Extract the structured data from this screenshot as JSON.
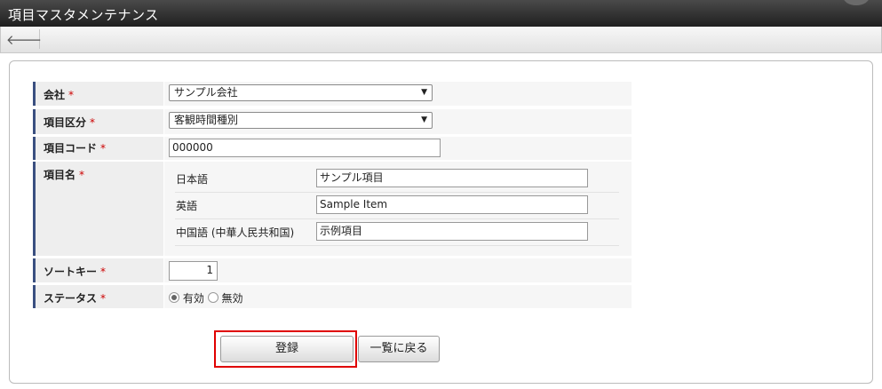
{
  "window": {
    "title": "項目マスタメンテナンス"
  },
  "toolbar": {
    "back_icon": "arrow-left-icon",
    "back_glyph": "🡐"
  },
  "form": {
    "required_mark": "*",
    "company": {
      "label": "会社",
      "value": "サンプル会社"
    },
    "category": {
      "label": "項目区分",
      "value": "客観時間種別"
    },
    "code": {
      "label": "項目コード",
      "value": "000000"
    },
    "name": {
      "label": "項目名",
      "languages": [
        {
          "label": "日本語",
          "value": "サンプル項目"
        },
        {
          "label": "英語",
          "value": "Sample Item"
        },
        {
          "label": "中国語 (中華人民共和国)",
          "value": "示例項目"
        }
      ]
    },
    "sort_key": {
      "label": "ソートキー",
      "value": "1"
    },
    "status": {
      "label": "ステータス",
      "options": [
        {
          "label": "有効",
          "selected": true
        },
        {
          "label": "無効",
          "selected": false
        }
      ]
    }
  },
  "actions": {
    "register": "登録",
    "back_to_list": "一覧に戻る"
  },
  "colors": {
    "label_accent": "#3a4f80",
    "required": "#cc0000",
    "highlight": "#e00000"
  }
}
